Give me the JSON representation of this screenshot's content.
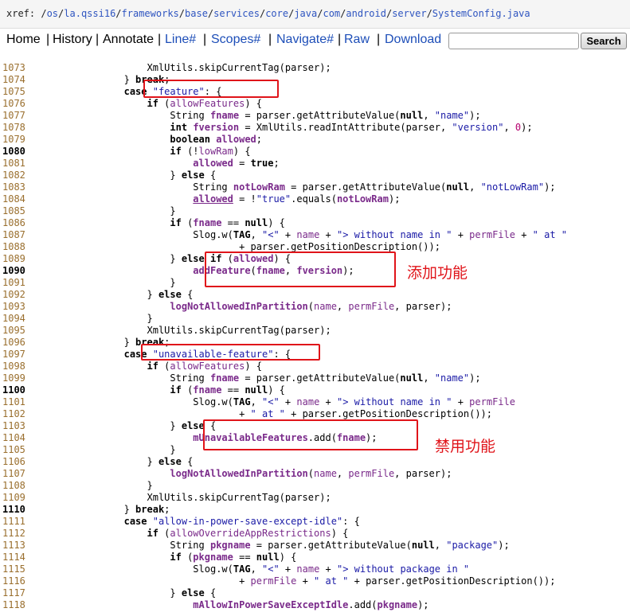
{
  "xref": {
    "prefix": "xref: /",
    "segments": [
      "os",
      "la.qssi16",
      "frameworks",
      "base",
      "services",
      "core",
      "java",
      "com",
      "android",
      "server",
      "SystemConfig.java"
    ]
  },
  "nav": {
    "home": "Home",
    "history": "History",
    "annotate": "Annotate",
    "line": "Line#",
    "scopes": "Scopes#",
    "navigate": "Navigate#",
    "raw": "Raw",
    "download": "Download",
    "search_placeholder": "",
    "search_label": "Search"
  },
  "annotations": {
    "add": "添加功能",
    "disable": "禁用功能"
  },
  "code": [
    {
      "n": "1073",
      "t": "                    XmlUtils.skipCurrentTag(parser);"
    },
    {
      "n": "1074",
      "t": "                } break;"
    },
    {
      "n": "1075",
      "t": "                case \"feature\": {"
    },
    {
      "n": "1076",
      "t": "                    if (allowFeatures) {"
    },
    {
      "n": "1077",
      "t": "                        String fname = parser.getAttributeValue(null, \"name\");"
    },
    {
      "n": "1078",
      "t": "                        int fversion = XmlUtils.readIntAttribute(parser, \"version\", 0);"
    },
    {
      "n": "1079",
      "t": "                        boolean allowed;"
    },
    {
      "n": "1080",
      "t": "                        if (!lowRam) {",
      "b": true
    },
    {
      "n": "1081",
      "t": "                            allowed = true;"
    },
    {
      "n": "1082",
      "t": "                        } else {"
    },
    {
      "n": "1083",
      "t": "                            String notLowRam = parser.getAttributeValue(null, \"notLowRam\");"
    },
    {
      "n": "1084",
      "t": "                            allowed = !\"true\".equals(notLowRam);"
    },
    {
      "n": "1085",
      "t": "                        }"
    },
    {
      "n": "1086",
      "t": "                        if (fname == null) {"
    },
    {
      "n": "1087",
      "t": "                            Slog.w(TAG, \"<\" + name + \"> without name in \" + permFile + \" at \""
    },
    {
      "n": "1088",
      "t": "                                    + parser.getPositionDescription());"
    },
    {
      "n": "1089",
      "t": "                        } else if (allowed) {"
    },
    {
      "n": "1090",
      "t": "                            addFeature(fname, fversion);",
      "b": true
    },
    {
      "n": "1091",
      "t": "                        }"
    },
    {
      "n": "1092",
      "t": "                    } else {"
    },
    {
      "n": "1093",
      "t": "                        logNotAllowedInPartition(name, permFile, parser);"
    },
    {
      "n": "1094",
      "t": "                    }"
    },
    {
      "n": "1095",
      "t": "                    XmlUtils.skipCurrentTag(parser);"
    },
    {
      "n": "1096",
      "t": "                } break;"
    },
    {
      "n": "1097",
      "t": "                case \"unavailable-feature\": {"
    },
    {
      "n": "1098",
      "t": "                    if (allowFeatures) {"
    },
    {
      "n": "1099",
      "t": "                        String fname = parser.getAttributeValue(null, \"name\");"
    },
    {
      "n": "1100",
      "t": "                        if (fname == null) {",
      "b": true
    },
    {
      "n": "1101",
      "t": "                            Slog.w(TAG, \"<\" + name + \"> without name in \" + permFile"
    },
    {
      "n": "1102",
      "t": "                                    + \" at \" + parser.getPositionDescription());"
    },
    {
      "n": "1103",
      "t": "                        } else {"
    },
    {
      "n": "1104",
      "t": "                            mUnavailableFeatures.add(fname);"
    },
    {
      "n": "1105",
      "t": "                        }"
    },
    {
      "n": "1106",
      "t": "                    } else {"
    },
    {
      "n": "1107",
      "t": "                        logNotAllowedInPartition(name, permFile, parser);"
    },
    {
      "n": "1108",
      "t": "                    }"
    },
    {
      "n": "1109",
      "t": "                    XmlUtils.skipCurrentTag(parser);"
    },
    {
      "n": "1110",
      "t": "                } break;",
      "b": true
    },
    {
      "n": "1111",
      "t": "                case \"allow-in-power-save-except-idle\": {"
    },
    {
      "n": "1112",
      "t": "                    if (allowOverrideAppRestrictions) {"
    },
    {
      "n": "1113",
      "t": "                        String pkgname = parser.getAttributeValue(null, \"package\");"
    },
    {
      "n": "1114",
      "t": "                        if (pkgname == null) {"
    },
    {
      "n": "1115",
      "t": "                            Slog.w(TAG, \"<\" + name + \"> without package in \""
    },
    {
      "n": "1116",
      "t": "                                    + permFile + \" at \" + parser.getPositionDescription());"
    },
    {
      "n": "1117",
      "t": "                        } else {"
    },
    {
      "n": "1118",
      "t": "                            mAllowInPowerSaveExceptIdle.add(pkgname);"
    }
  ]
}
